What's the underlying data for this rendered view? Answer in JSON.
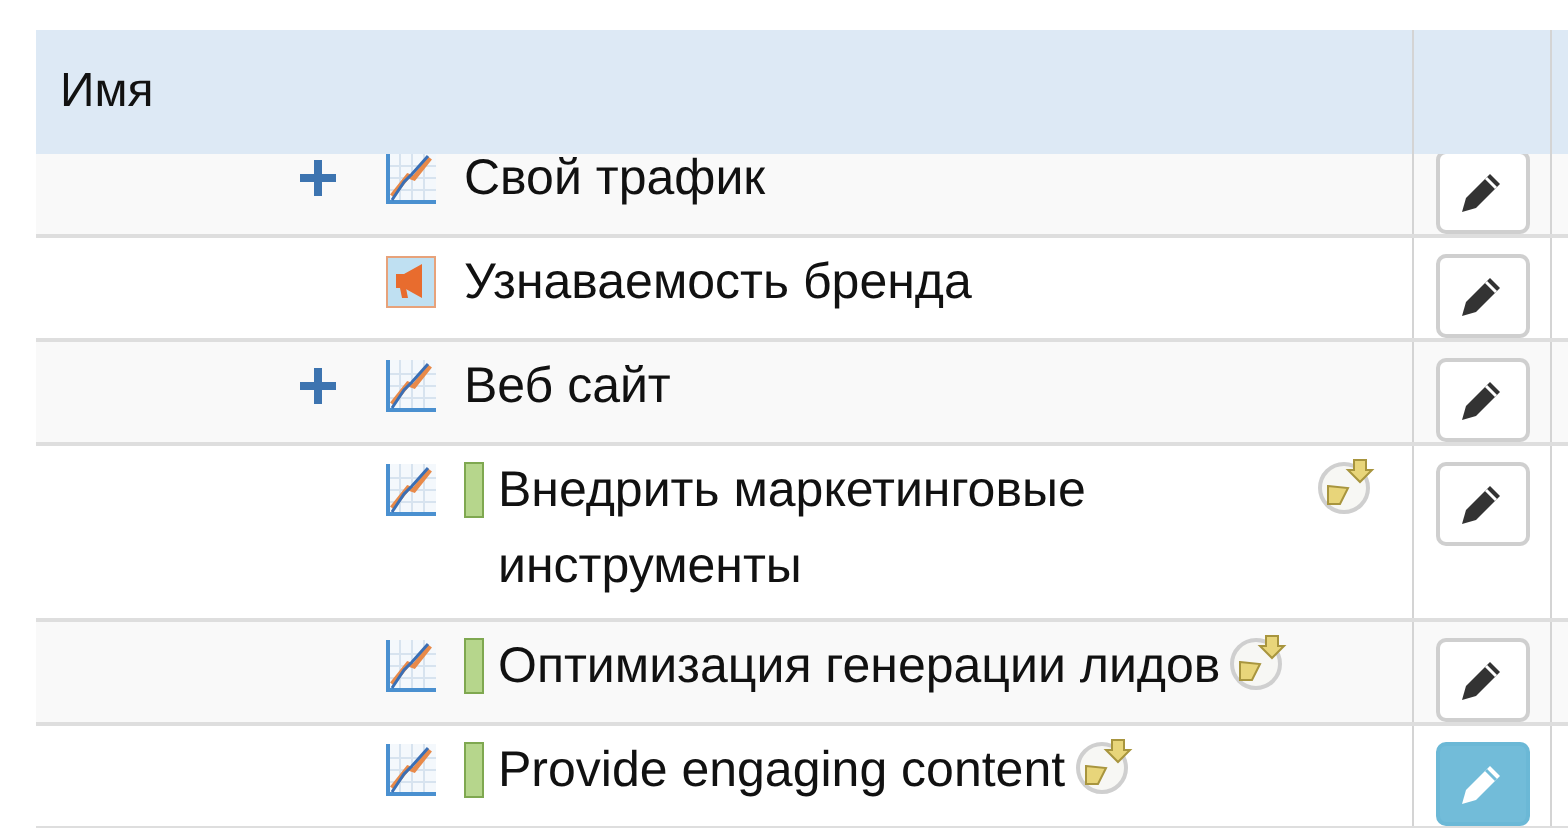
{
  "table": {
    "columns": [
      {
        "label": "Имя"
      }
    ],
    "rows": [
      {
        "expandable": true,
        "kind": "chart",
        "flag": false,
        "label": "Свой трафик",
        "status": false,
        "edit_active": false
      },
      {
        "expandable": false,
        "kind": "megaphone",
        "flag": false,
        "label": "Узнаваемость бренда",
        "status": false,
        "edit_active": false
      },
      {
        "expandable": true,
        "kind": "chart",
        "flag": false,
        "label": "Веб сайт",
        "status": false,
        "edit_active": false
      },
      {
        "expandable": false,
        "kind": "chart",
        "flag": true,
        "label": "Внедрить маркетинговые инструменты",
        "status": true,
        "edit_active": false
      },
      {
        "expandable": false,
        "kind": "chart",
        "flag": true,
        "label": "Оптимизация генерации лидов",
        "status": true,
        "edit_active": false
      },
      {
        "expandable": false,
        "kind": "chart",
        "flag": true,
        "label": "Provide engaging content",
        "status": true,
        "edit_active": true
      }
    ]
  }
}
